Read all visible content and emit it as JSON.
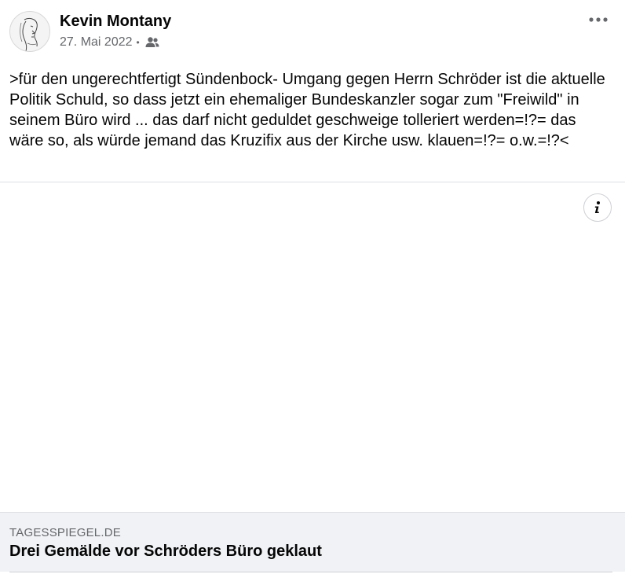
{
  "post": {
    "author_name": "Kevin Montany",
    "date": "27. Mai 2022",
    "separator": "•",
    "audience_icon": "friends-icon",
    "more_icon": "more-horizontal-icon",
    "text": ">für den ungerechtfertigt Sündenbock- Umgang gegen Herrn Schröder ist die aktuelle Politik Schuld, so dass jetzt ein ehemaliger Bundeskanzler sogar zum \"Freiwild\" in seinem Büro wird ... das darf nicht geduldet geschweige tolleriert werden=!?= das wäre so, als würde jemand das Kruzifix aus der Kirche usw. klauen=!?= o.w.=!?<"
  },
  "media": {
    "info_icon": "info-icon"
  },
  "link_preview": {
    "domain": "TAGESSPIEGEL.DE",
    "title": "Drei Gemälde vor Schröders Büro geklaut"
  },
  "colors": {
    "text_primary": "#050505",
    "text_secondary": "#65676b",
    "preview_background": "#f0f2f5",
    "divider": "#dddfe2"
  }
}
